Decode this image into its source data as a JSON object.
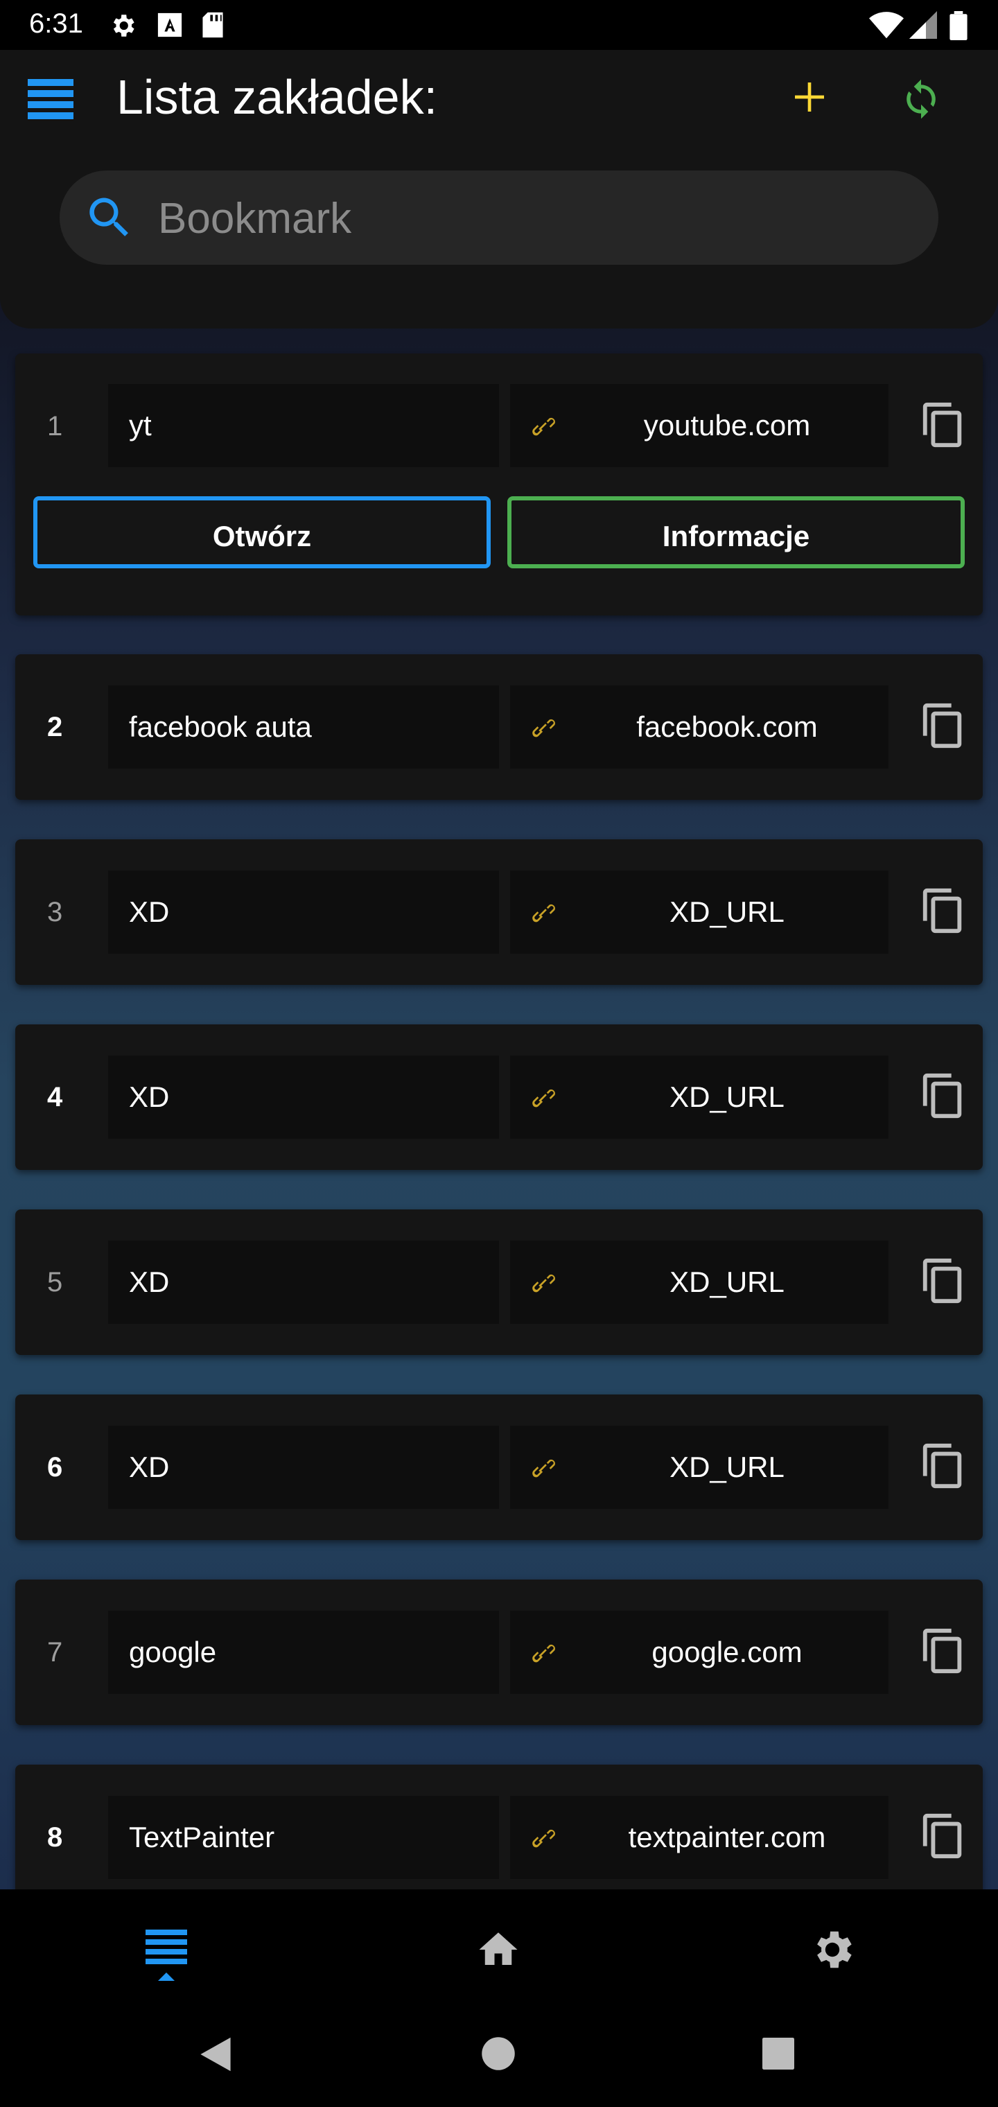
{
  "status_bar": {
    "time": "6:31"
  },
  "header": {
    "title": "Lista zakładek:",
    "search_placeholder": "Bookmark",
    "search_value": ""
  },
  "bookmarks": [
    {
      "index": "1",
      "name": "yt",
      "url": "youtube.com",
      "expanded": true
    },
    {
      "index": "2",
      "name": "facebook auta",
      "url": "facebook.com"
    },
    {
      "index": "3",
      "name": "XD",
      "url": "XD_URL"
    },
    {
      "index": "4",
      "name": "XD",
      "url": "XD_URL"
    },
    {
      "index": "5",
      "name": "XD",
      "url": "XD_URL"
    },
    {
      "index": "6",
      "name": "XD",
      "url": "XD_URL"
    },
    {
      "index": "7",
      "name": "google",
      "url": "google.com"
    },
    {
      "index": "8",
      "name": "TextPainter",
      "url": "textpainter.com"
    }
  ],
  "expanded_actions": {
    "open_label": "Otwórz",
    "info_label": "Informacje"
  },
  "bottom_nav": [
    {
      "icon": "list-icon",
      "active": true
    },
    {
      "icon": "home-icon",
      "active": false
    },
    {
      "icon": "settings-icon",
      "active": false
    }
  ],
  "colors": {
    "accent_blue": "#2196f3",
    "accent_green": "#4caf50",
    "accent_yellow": "#fdd835",
    "link_gold": "#c9a227"
  }
}
